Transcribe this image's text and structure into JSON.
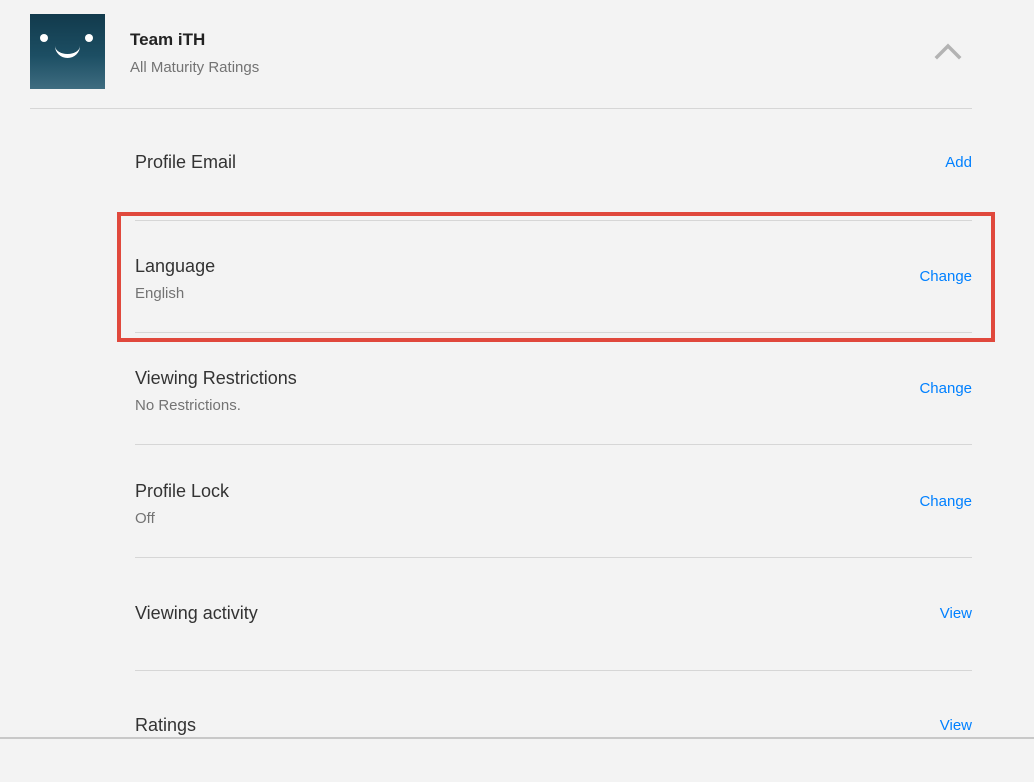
{
  "profile": {
    "name": "Team iTH",
    "maturity": "All Maturity Ratings",
    "avatar_icon": "smiley-avatar-icon",
    "collapse_icon": "chevron-up-icon"
  },
  "settings": [
    {
      "title": "Profile Email",
      "value": "",
      "action": "Add"
    },
    {
      "title": "Language",
      "value": "English",
      "action": "Change"
    },
    {
      "title": "Viewing Restrictions",
      "value": "No Restrictions.",
      "action": "Change"
    },
    {
      "title": "Profile Lock",
      "value": "Off",
      "action": "Change"
    },
    {
      "title": "Viewing activity",
      "value": "",
      "action": "View"
    },
    {
      "title": "Ratings",
      "value": "",
      "action": "View"
    }
  ],
  "colors": {
    "link": "#0080ff",
    "highlight": "#e0483c",
    "background": "#f3f3f3"
  }
}
